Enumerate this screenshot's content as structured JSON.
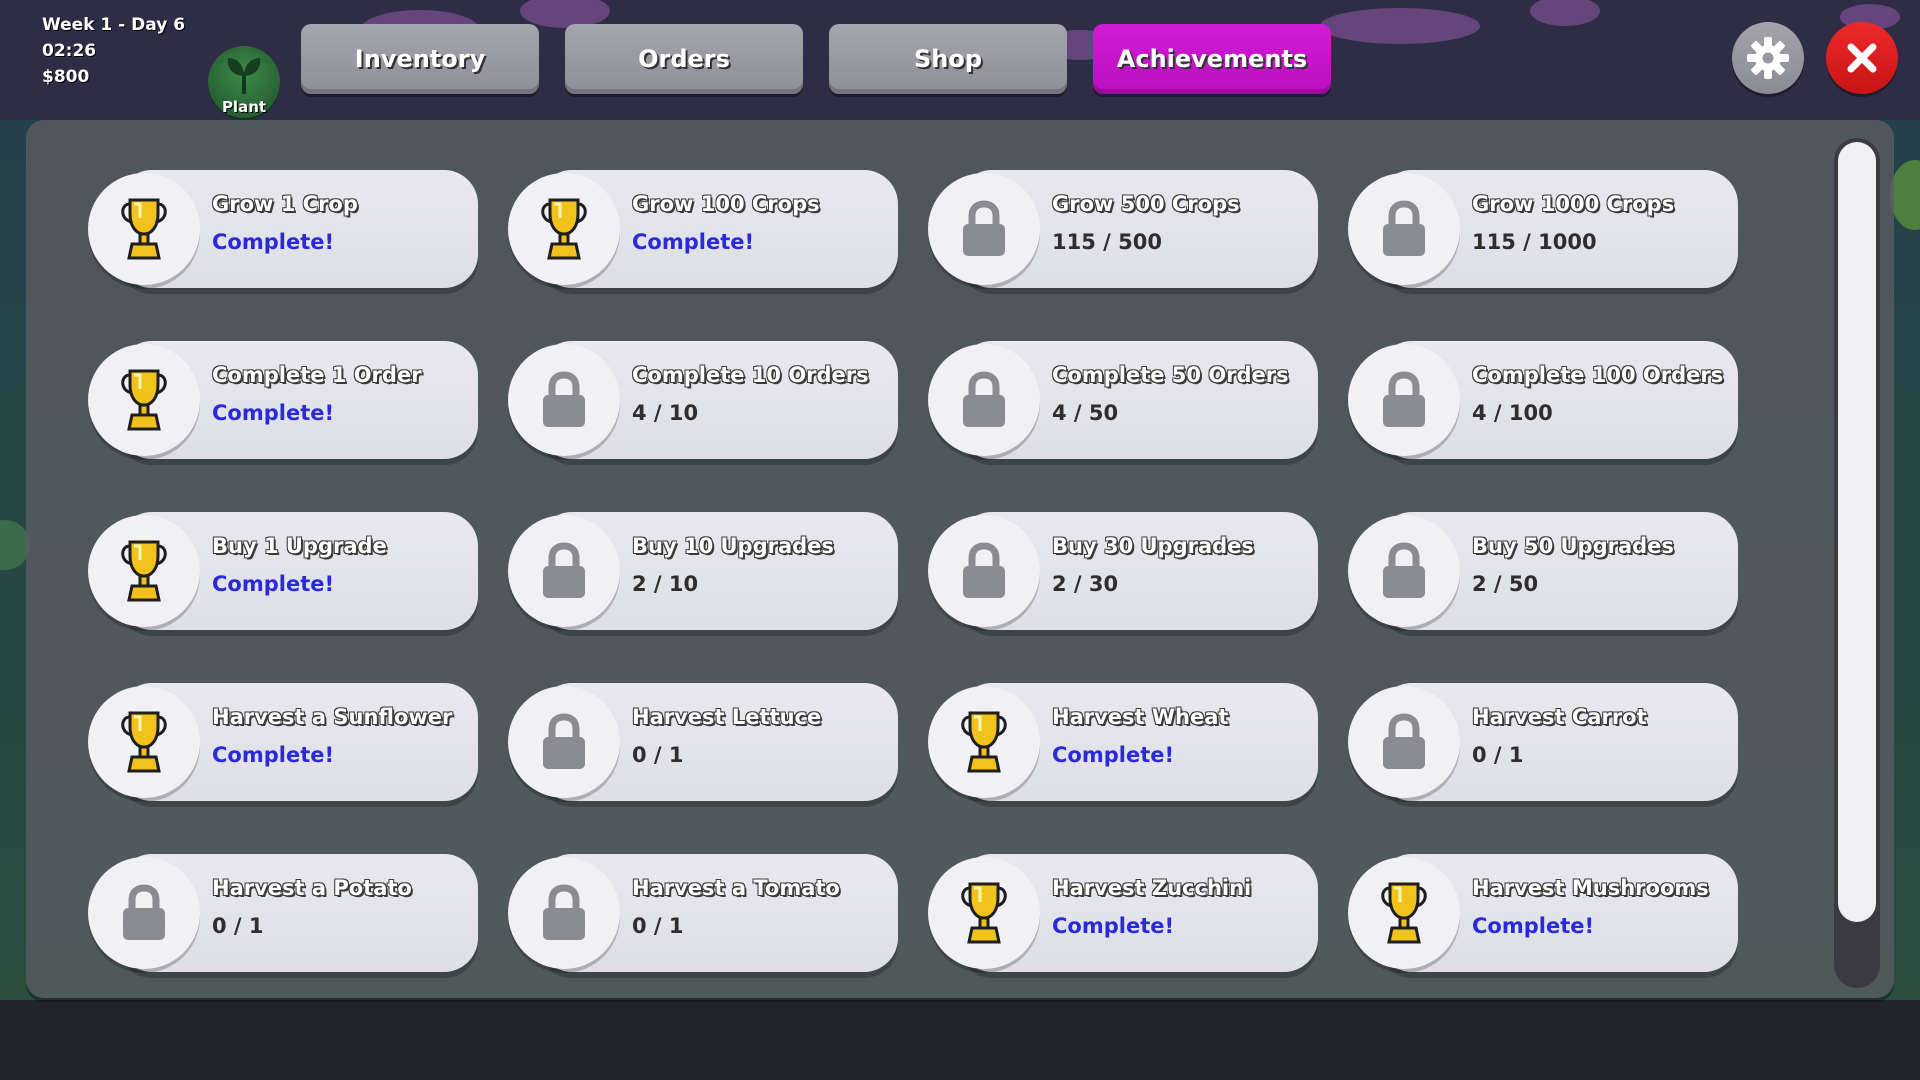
{
  "hud": {
    "week_day": "Week 1 - Day 6",
    "time": "02:26",
    "money": "$800"
  },
  "plant": {
    "label": "Plant",
    "icon": "sprout-icon"
  },
  "tabs": [
    {
      "label": "Inventory",
      "active": false
    },
    {
      "label": "Orders",
      "active": false
    },
    {
      "label": "Shop",
      "active": false
    },
    {
      "label": "Achievements",
      "active": true
    }
  ],
  "colors": {
    "active_tab": "#c716cc",
    "close": "#d91c1c",
    "complete_text": "#2a2ad8",
    "trophy": "#f1c21b"
  },
  "achievements": [
    {
      "title": "Grow 1 Crop",
      "status": "Complete!",
      "done": true
    },
    {
      "title": "Grow 100 Crops",
      "status": "Complete!",
      "done": true
    },
    {
      "title": "Grow 500 Crops",
      "status": "115 / 500",
      "done": false
    },
    {
      "title": "Grow 1000 Crops",
      "status": "115 / 1000",
      "done": false
    },
    {
      "title": "Complete 1 Order",
      "status": "Complete!",
      "done": true
    },
    {
      "title": "Complete 10 Orders",
      "status": "4 / 10",
      "done": false
    },
    {
      "title": "Complete 50 Orders",
      "status": "4 / 50",
      "done": false
    },
    {
      "title": "Complete 100 Orders",
      "status": "4 / 100",
      "done": false
    },
    {
      "title": "Buy 1 Upgrade",
      "status": "Complete!",
      "done": true
    },
    {
      "title": "Buy 10 Upgrades",
      "status": "2 / 10",
      "done": false
    },
    {
      "title": "Buy 30 Upgrades",
      "status": "2 / 30",
      "done": false
    },
    {
      "title": "Buy 50 Upgrades",
      "status": "2 / 50",
      "done": false
    },
    {
      "title": "Harvest a Sunflower",
      "status": "Complete!",
      "done": true
    },
    {
      "title": "Harvest Lettuce",
      "status": "0 / 1",
      "done": false
    },
    {
      "title": "Harvest Wheat",
      "status": "Complete!",
      "done": true
    },
    {
      "title": "Harvest Carrot",
      "status": "0 / 1",
      "done": false
    },
    {
      "title": "Harvest a Potato",
      "status": "0 / 1",
      "done": false
    },
    {
      "title": "Harvest a Tomato",
      "status": "0 / 1",
      "done": false
    },
    {
      "title": "Harvest Zucchini",
      "status": "Complete!",
      "done": true
    },
    {
      "title": "Harvest Mushrooms",
      "status": "Complete!",
      "done": true
    }
  ]
}
